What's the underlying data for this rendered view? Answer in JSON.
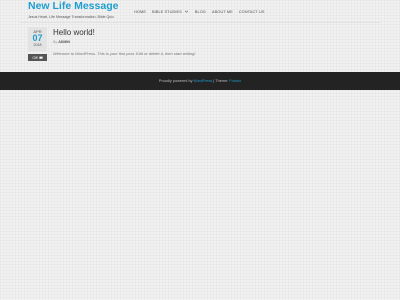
{
  "site": {
    "title": "New Life Message",
    "tagline": "Jesus Heart, Life Message Transformation, Bible Quiz"
  },
  "nav": {
    "items": [
      {
        "label": "Home",
        "has_dropdown": false
      },
      {
        "label": "Bible Studies",
        "has_dropdown": true
      },
      {
        "label": "Blog",
        "has_dropdown": false
      },
      {
        "label": "About Me",
        "has_dropdown": false
      },
      {
        "label": "Contact Us",
        "has_dropdown": false
      }
    ]
  },
  "post": {
    "date": {
      "month": "APR",
      "day": "07",
      "year": "2018"
    },
    "comments_label": "Off",
    "title": "Hello world!",
    "meta_prefix": "By",
    "author": "ADMIN",
    "excerpt": "Welcome to WordPress. This is your first post. Edit or delete it, then start writing!"
  },
  "footer": {
    "prefix": "Proudly powered by",
    "wordpress_link": "WordPress",
    "separator": "|",
    "theme_prefix": "Theme:",
    "theme_link": "Futurio"
  },
  "colors": {
    "accent": "#1d9ecf",
    "footer_background": "#232323",
    "page_background": "#f1f1f1"
  }
}
